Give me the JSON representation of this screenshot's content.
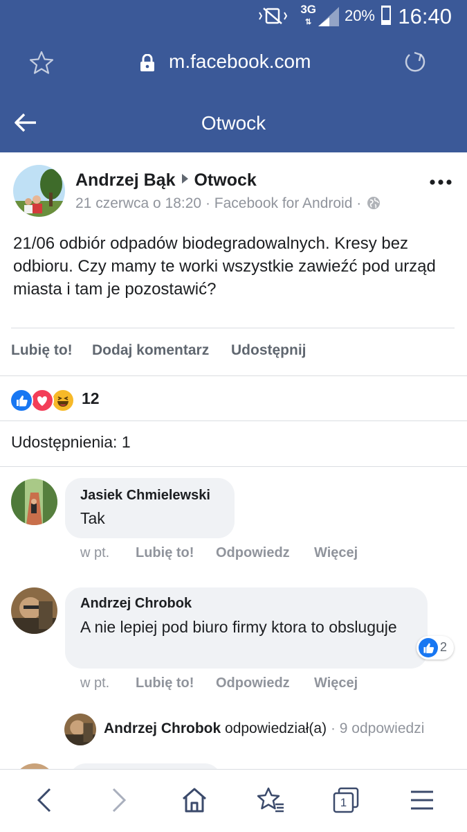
{
  "status_bar": {
    "network": "3G",
    "battery": "20%",
    "time": "16:40"
  },
  "browser": {
    "url": "m.facebook.com"
  },
  "header": {
    "title": "Otwock"
  },
  "post": {
    "author": "Andrzej Bąk",
    "target": "Otwock",
    "meta": "21 czerwca o 18:20 · Facebook for Android ·",
    "text": "21/06 odbiór odpadów biodegradowalnych. Kresy bez odbioru. Czy mamy te worki wszystkie zawieźć pod urząd miasta i tam je pozostawić?",
    "actions": {
      "like": "Lubię to!",
      "comment": "Dodaj komentarz",
      "share": "Udostępnij"
    },
    "reaction_count": "12",
    "reactions": [
      "like",
      "love",
      "haha"
    ],
    "shares": "Udostępnienia: 1"
  },
  "comments": [
    {
      "name": "Jasiek Chmielewski",
      "text": "Tak",
      "when": "w pt.",
      "like": "Lubię to!",
      "reply": "Odpowiedz",
      "more": "Więcej"
    },
    {
      "name": "Andrzej Chrobok",
      "text": "A nie lepiej pod biuro firmy ktora to obsluguje",
      "when": "w pt.",
      "like": "Lubię to!",
      "reply": "Odpowiedz",
      "more": "Więcej",
      "like_count": "2",
      "replies": {
        "name": "Andrzej Chrobok",
        "verb": "odpowiedział(a)",
        "count": "· 9 odpowiedzi"
      }
    }
  ],
  "bottom_nav": {
    "tab_count": "1"
  },
  "colors": {
    "brand": "#3b5998",
    "like_blue": "#1877f2",
    "love_red": "#f33e58",
    "haha_yellow": "#f7b928"
  }
}
